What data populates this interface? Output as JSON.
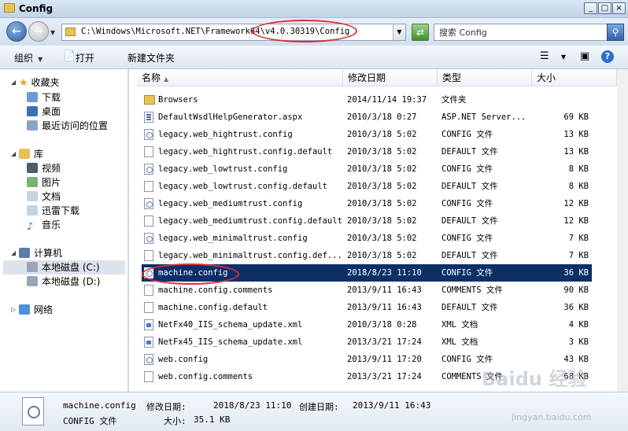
{
  "window": {
    "title": "Config",
    "minimize": "_",
    "maximize": "□",
    "close": "×"
  },
  "address": {
    "path": "C:\\Windows\\Microsoft.NET\\Framework64\\v4.0.30319\\Config"
  },
  "search": {
    "placeholder": "搜索 Config"
  },
  "toolbar": {
    "organize": "组织",
    "open": "打开",
    "new_folder": "新建文件夹",
    "help": "?"
  },
  "nav": {
    "favorites": "收藏夹",
    "downloads": "下载",
    "desktop": "桌面",
    "recent": "最近访问的位置",
    "libraries": "库",
    "videos": "视频",
    "pictures": "图片",
    "documents": "文档",
    "xunlei": "迅雷下载",
    "music": "音乐",
    "computer": "计算机",
    "drive_c": "本地磁盘 (C:)",
    "drive_d": "本地磁盘 (D:)",
    "network": "网络"
  },
  "columns": {
    "name": "名称",
    "modified": "修改日期",
    "type": "类型",
    "size": "大小"
  },
  "files": [
    {
      "name": "Browsers",
      "modified": "2014/11/14 19:37",
      "type": "文件夹",
      "size": "",
      "icon": "folder"
    },
    {
      "name": "DefaultWsdlHelpGenerator.aspx",
      "modified": "2010/3/18 0:27",
      "type": "ASP.NET Server...",
      "size": "69 KB",
      "icon": "aspx"
    },
    {
      "name": "legacy.web_hightrust.config",
      "modified": "2010/3/18 5:02",
      "type": "CONFIG 文件",
      "size": "13 KB",
      "icon": "cfg"
    },
    {
      "name": "legacy.web_hightrust.config.default",
      "modified": "2010/3/18 5:02",
      "type": "DEFAULT 文件",
      "size": "13 KB",
      "icon": "file"
    },
    {
      "name": "legacy.web_lowtrust.config",
      "modified": "2010/3/18 5:02",
      "type": "CONFIG 文件",
      "size": "8 KB",
      "icon": "cfg"
    },
    {
      "name": "legacy.web_lowtrust.config.default",
      "modified": "2010/3/18 5:02",
      "type": "DEFAULT 文件",
      "size": "8 KB",
      "icon": "file"
    },
    {
      "name": "legacy.web_mediumtrust.config",
      "modified": "2010/3/18 5:02",
      "type": "CONFIG 文件",
      "size": "12 KB",
      "icon": "cfg"
    },
    {
      "name": "legacy.web_mediumtrust.config.default",
      "modified": "2010/3/18 5:02",
      "type": "DEFAULT 文件",
      "size": "12 KB",
      "icon": "file"
    },
    {
      "name": "legacy.web_minimaltrust.config",
      "modified": "2010/3/18 5:02",
      "type": "CONFIG 文件",
      "size": "7 KB",
      "icon": "cfg"
    },
    {
      "name": "legacy.web_minimaltrust.config.def...",
      "modified": "2010/3/18 5:02",
      "type": "DEFAULT 文件",
      "size": "7 KB",
      "icon": "file"
    },
    {
      "name": "machine.config",
      "modified": "2018/8/23 11:10",
      "type": "CONFIG 文件",
      "size": "36 KB",
      "icon": "cfg",
      "selected": true
    },
    {
      "name": "machine.config.comments",
      "modified": "2013/9/11 16:43",
      "type": "COMMENTS 文件",
      "size": "90 KB",
      "icon": "file"
    },
    {
      "name": "machine.config.default",
      "modified": "2013/9/11 16:43",
      "type": "DEFAULT 文件",
      "size": "36 KB",
      "icon": "file"
    },
    {
      "name": "NetFx40_IIS_schema_update.xml",
      "modified": "2010/3/18 0:28",
      "type": "XML 文档",
      "size": "4 KB",
      "icon": "xml"
    },
    {
      "name": "NetFx45_IIS_schema_update.xml",
      "modified": "2013/3/21 17:24",
      "type": "XML 文档",
      "size": "3 KB",
      "icon": "xml"
    },
    {
      "name": "web.config",
      "modified": "2013/9/11 17:20",
      "type": "CONFIG 文件",
      "size": "43 KB",
      "icon": "cfg"
    },
    {
      "name": "web.config.comments",
      "modified": "2013/3/21 17:24",
      "type": "COMMENTS 文件",
      "size": "68 KB",
      "icon": "file"
    }
  ],
  "details": {
    "filename": "machine.config",
    "filetype": "CONFIG 文件",
    "modified_label": "修改日期:",
    "modified_value": "2018/8/23 11:10",
    "size_label": "大小:",
    "size_value": "35.1 KB",
    "created_label": "创建日期:",
    "created_value": "2013/9/11 16:43"
  },
  "watermark": {
    "logo": "Baidu 经验",
    "url": "jingyan.baidu.com"
  }
}
